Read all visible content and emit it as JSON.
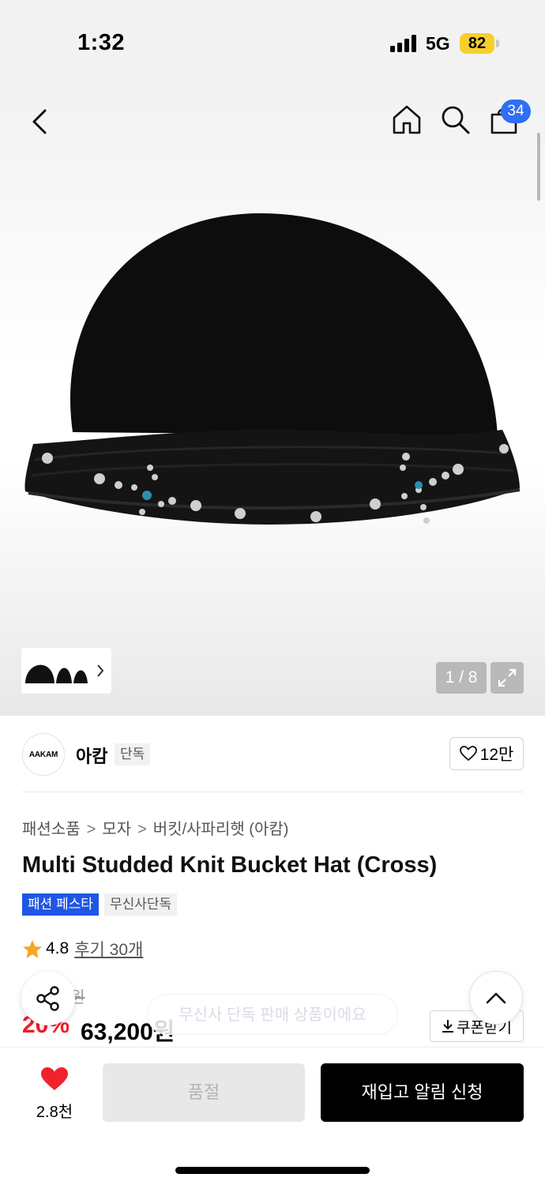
{
  "status": {
    "time": "1:32",
    "network": "5G",
    "battery": "82"
  },
  "header": {
    "cart_count": "34"
  },
  "gallery": {
    "counter": "1 / 8",
    "hero_icon": "knit-bucket-hat"
  },
  "brand": {
    "logo_text": "AAKAM",
    "name": "아캄",
    "tag": "단독",
    "likes": "12만"
  },
  "breadcrumb": {
    "level1": "패션소품",
    "level2": "모자",
    "level3": "버킷/사파리햇 (아캄)"
  },
  "product": {
    "title": "Multi Studded Knit Bucket Hat (Cross)",
    "tags": [
      "패션 페스타",
      "무신사단독"
    ],
    "rating": "4.8",
    "reviews": "후기 30개",
    "original_price": "79,000원",
    "discount": "20%",
    "price": "63,200원"
  },
  "overlay": {
    "exclusive_pill": "무신사 단독 판매 상품이에요"
  },
  "actions": {
    "coupon": "쿠폰받기",
    "wish_count": "2.8천",
    "sold_out": "품절",
    "restock": "재입고 알림 신청"
  },
  "colors": {
    "accent_blue": "#2f6ef6",
    "fest_blue": "#1f56e6",
    "sale_red": "#f21c27",
    "heart_red": "#f0232c",
    "star": "#f5a623"
  }
}
